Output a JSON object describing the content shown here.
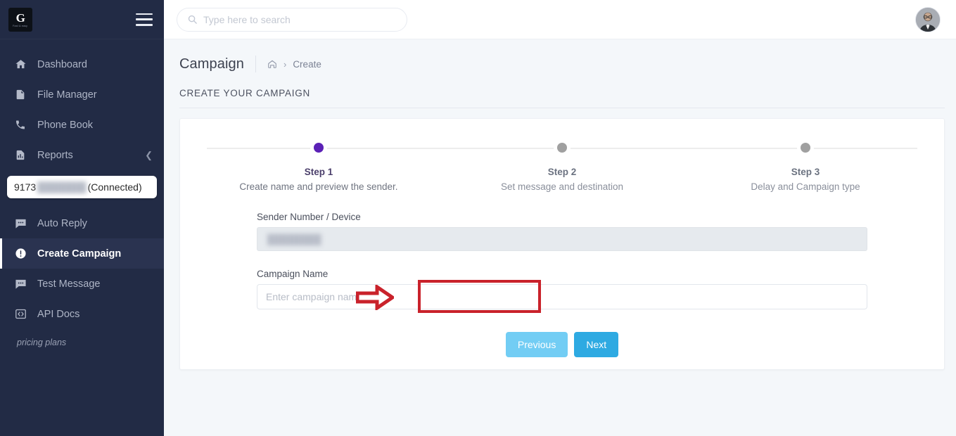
{
  "brand": {
    "logo_letter": "G",
    "logo_subtext": "Fast & easy",
    "colors": {
      "sidebar_bg": "#222b45",
      "page_bg": "#f4f7fa",
      "step_active": "#5b21b6",
      "step_inactive": "#a0a0a0",
      "btn_previous": "#72cdf4",
      "btn_next": "#2eaae2",
      "annotation_red": "#c9222b"
    }
  },
  "sidebar": {
    "menu_icon": "hamburger-icon",
    "items": [
      {
        "label": "Dashboard",
        "icon": "home-icon",
        "active": false,
        "chevron": false
      },
      {
        "label": "File Manager",
        "icon": "file-icon",
        "active": false,
        "chevron": false
      },
      {
        "label": "Phone Book",
        "icon": "phone-icon",
        "active": false,
        "chevron": false
      },
      {
        "label": "Reports",
        "icon": "report-chart-icon",
        "active": false,
        "chevron": true
      }
    ],
    "device_pill": {
      "number_prefix": "9173",
      "number_masked": "          ",
      "status": "(Connected)"
    },
    "items_lower": [
      {
        "label": "Auto Reply",
        "icon": "chat-icon",
        "active": false
      },
      {
        "label": "Create Campaign",
        "icon": "alert-circle-icon",
        "active": true
      },
      {
        "label": "Test Message",
        "icon": "chat-icon",
        "active": false
      },
      {
        "label": "API Docs",
        "icon": "code-brackets-icon",
        "active": false
      }
    ],
    "pricing_link": "pricing plans"
  },
  "topbar": {
    "search": {
      "placeholder": "Type here to search",
      "value": "",
      "icon": "search-icon"
    },
    "avatar": "user-avatar"
  },
  "page": {
    "title": "Campaign",
    "breadcrumb": {
      "home_icon": "home-icon",
      "separator": "›",
      "current": "Create"
    },
    "section_label": "CREATE YOUR CAMPAIGN"
  },
  "stepper": {
    "steps": [
      {
        "title": "Step 1",
        "desc": "Create name and preview the sender.",
        "state": "current"
      },
      {
        "title": "Step 2",
        "desc": "Set message and destination",
        "state": "upcoming"
      },
      {
        "title": "Step 3",
        "desc": "Delay and Campaign type",
        "state": "upcoming"
      }
    ]
  },
  "form": {
    "sender": {
      "label": "Sender Number / Device",
      "value_masked": "              ",
      "disabled": true
    },
    "campaign_name": {
      "label": "Campaign Name",
      "placeholder": "Enter campaign name",
      "value": ""
    },
    "buttons": {
      "previous": "Previous",
      "next": "Next"
    }
  },
  "annotations": {
    "highlight_box": "campaign-name-highlight",
    "arrow": "pointer-arrow-right"
  }
}
